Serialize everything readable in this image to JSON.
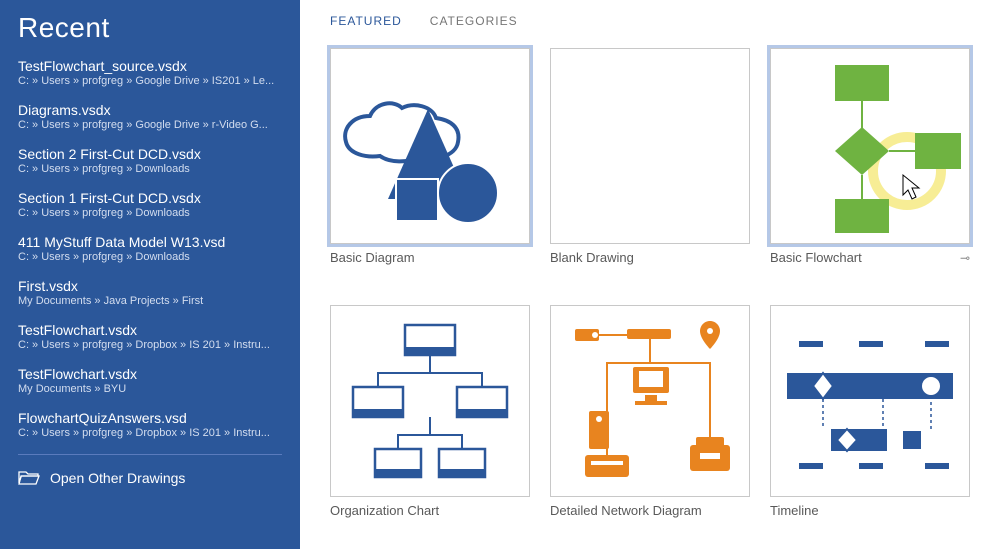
{
  "sidebar": {
    "title": "Recent",
    "open_other": "Open Other Drawings",
    "items": [
      {
        "name": "TestFlowchart_source.vsdx",
        "path": "C: » Users » profgreg » Google Drive » IS201 » Le..."
      },
      {
        "name": "Diagrams.vsdx",
        "path": "C: » Users » profgreg » Google Drive » r-Video G..."
      },
      {
        "name": "Section 2 First-Cut DCD.vsdx",
        "path": "C: » Users » profgreg » Downloads"
      },
      {
        "name": "Section 1 First-Cut DCD.vsdx",
        "path": "C: » Users » profgreg » Downloads"
      },
      {
        "name": "411 MyStuff Data Model W13.vsd",
        "path": "C: » Users » profgreg » Downloads"
      },
      {
        "name": "First.vsdx",
        "path": "My Documents » Java Projects » First"
      },
      {
        "name": "TestFlowchart.vsdx",
        "path": "C: » Users » profgreg » Dropbox » IS 201 » Instru..."
      },
      {
        "name": "TestFlowchart.vsdx",
        "path": "My Documents » BYU"
      },
      {
        "name": "FlowchartQuizAnswers.vsd",
        "path": "C: » Users » profgreg » Dropbox » IS 201 » Instru..."
      }
    ]
  },
  "tabs": {
    "featured": "FEATURED",
    "categories": "CATEGORIES",
    "active": "featured"
  },
  "templates": [
    {
      "label": "Basic Diagram",
      "selected": true
    },
    {
      "label": "Blank Drawing",
      "selected": false
    },
    {
      "label": "Basic Flowchart",
      "selected": true,
      "pinned": true,
      "cursor": true
    },
    {
      "label": "Organization Chart",
      "selected": false
    },
    {
      "label": "Detailed Network Diagram",
      "selected": false
    },
    {
      "label": "Timeline",
      "selected": false
    }
  ],
  "colors": {
    "brand": "#2b579a",
    "accent_green": "#6fb341",
    "accent_orange": "#e8841f"
  }
}
